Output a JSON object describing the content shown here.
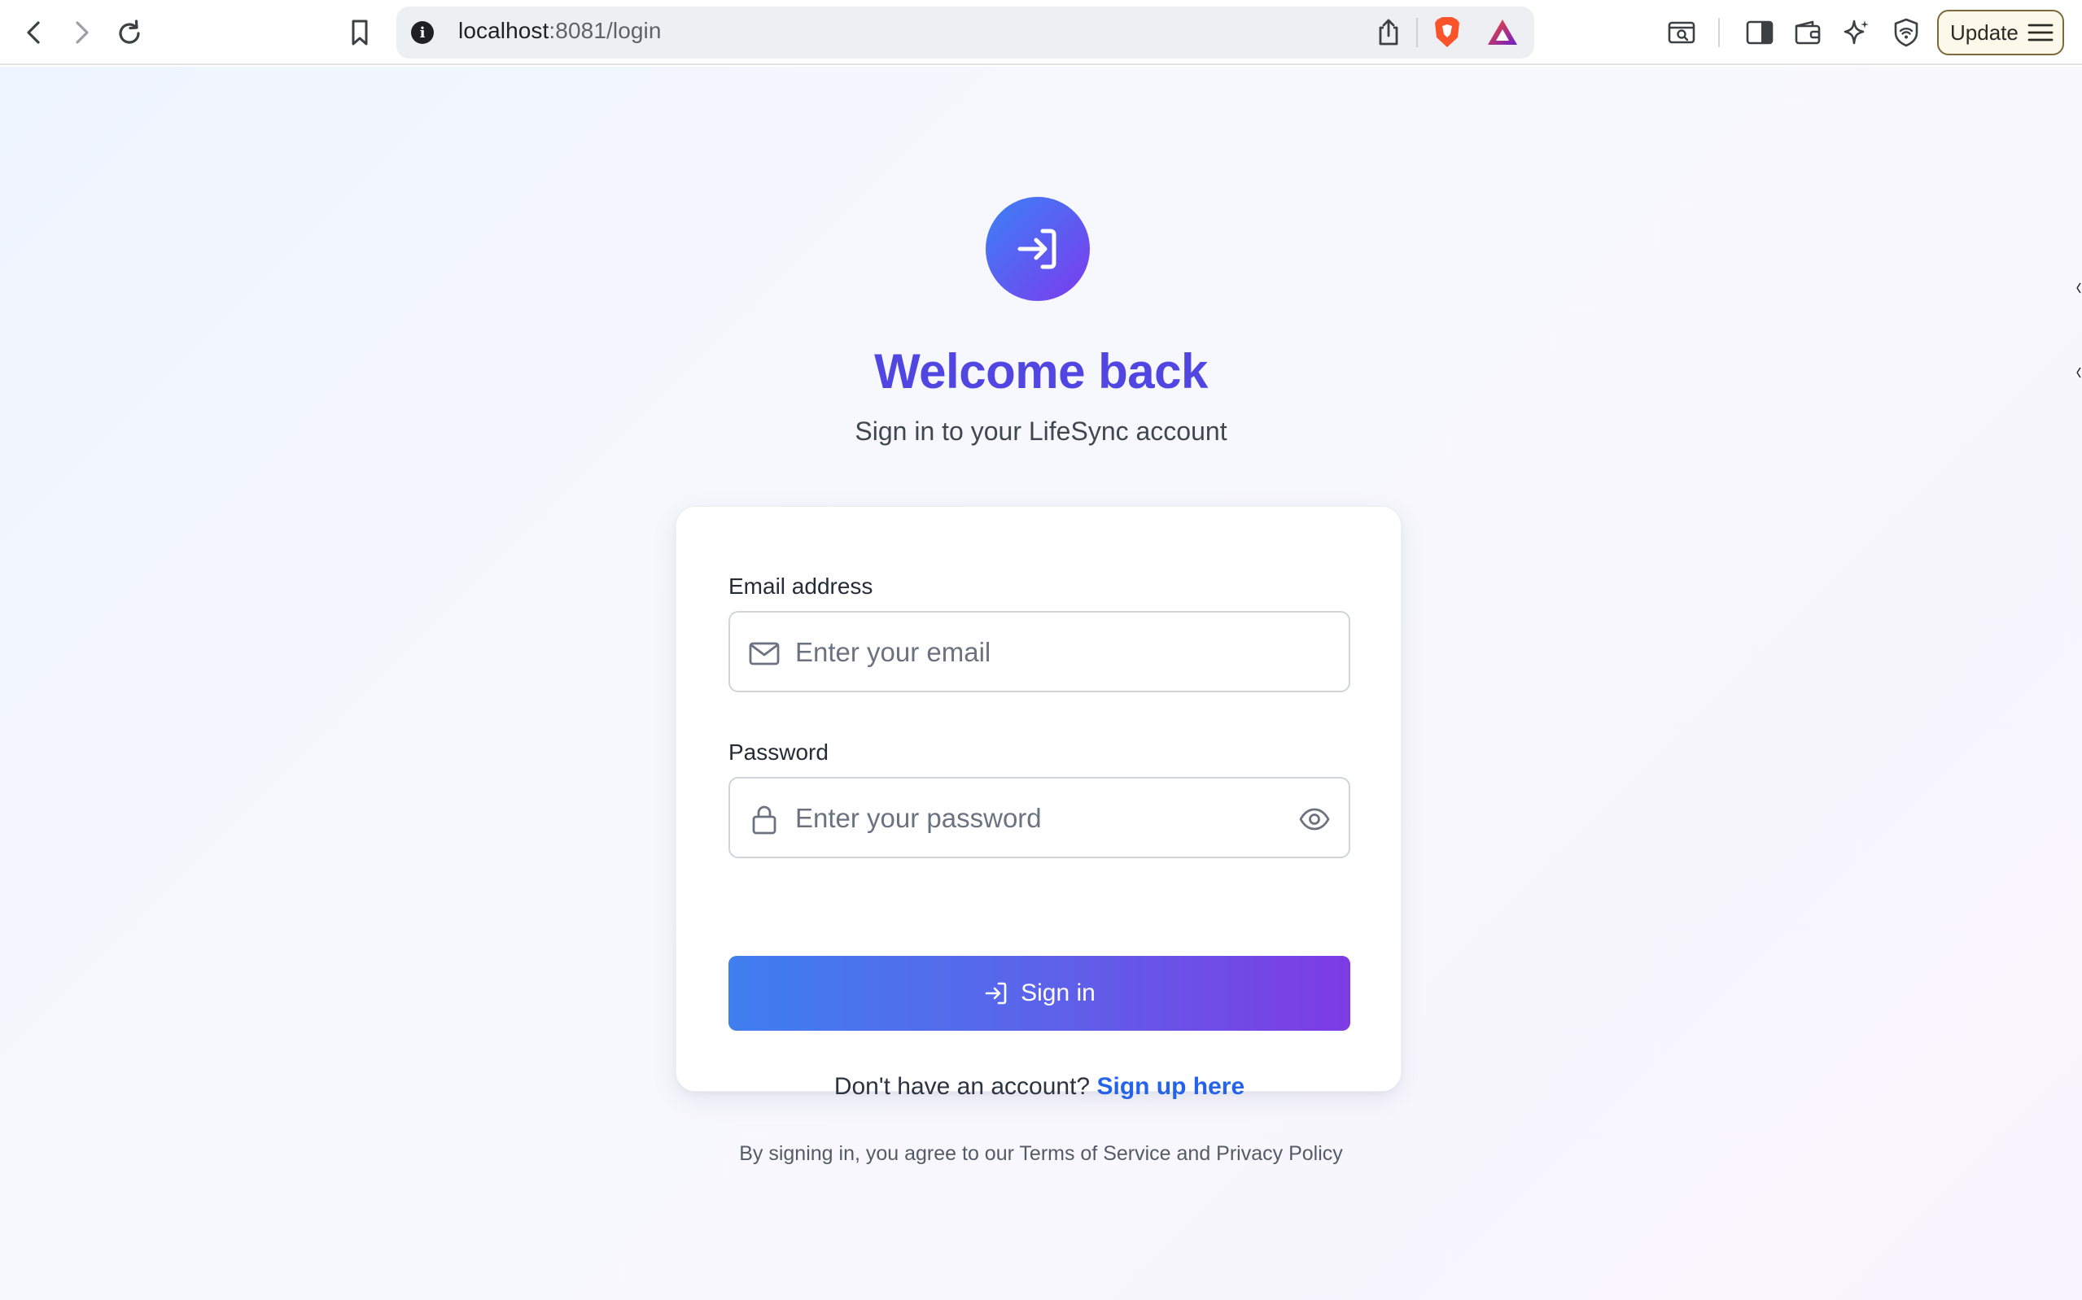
{
  "browser": {
    "url_host": "localhost",
    "url_path": ":8081/login",
    "update_label": "Update",
    "icons": [
      "back-icon",
      "forward-icon",
      "reload-icon",
      "bookmark-icon",
      "site-info-icon",
      "share-icon",
      "brave-shields-icon",
      "brave-rewards-icon",
      "search-tab-icon",
      "sidebar-icon",
      "wallet-icon",
      "leo-ai-icon",
      "vpn-icon",
      "menu-icon"
    ]
  },
  "page": {
    "title": "Welcome back",
    "subtitle": "Sign in to your LifeSync account",
    "email_label": "Email address",
    "email_placeholder": "Enter your email",
    "password_label": "Password",
    "password_placeholder": "Enter your password",
    "signin_label": "Sign in",
    "signup_prompt": "Don't have an account?",
    "signup_link": "Sign up here",
    "terms_text": "By signing in, you agree to our Terms of Service and Privacy Policy"
  },
  "colors": {
    "title": "#5146e2",
    "button_start": "#3f7ff0",
    "button_end": "#7e3be3",
    "link": "#2563eb",
    "brave_orange": "#fb542b"
  }
}
